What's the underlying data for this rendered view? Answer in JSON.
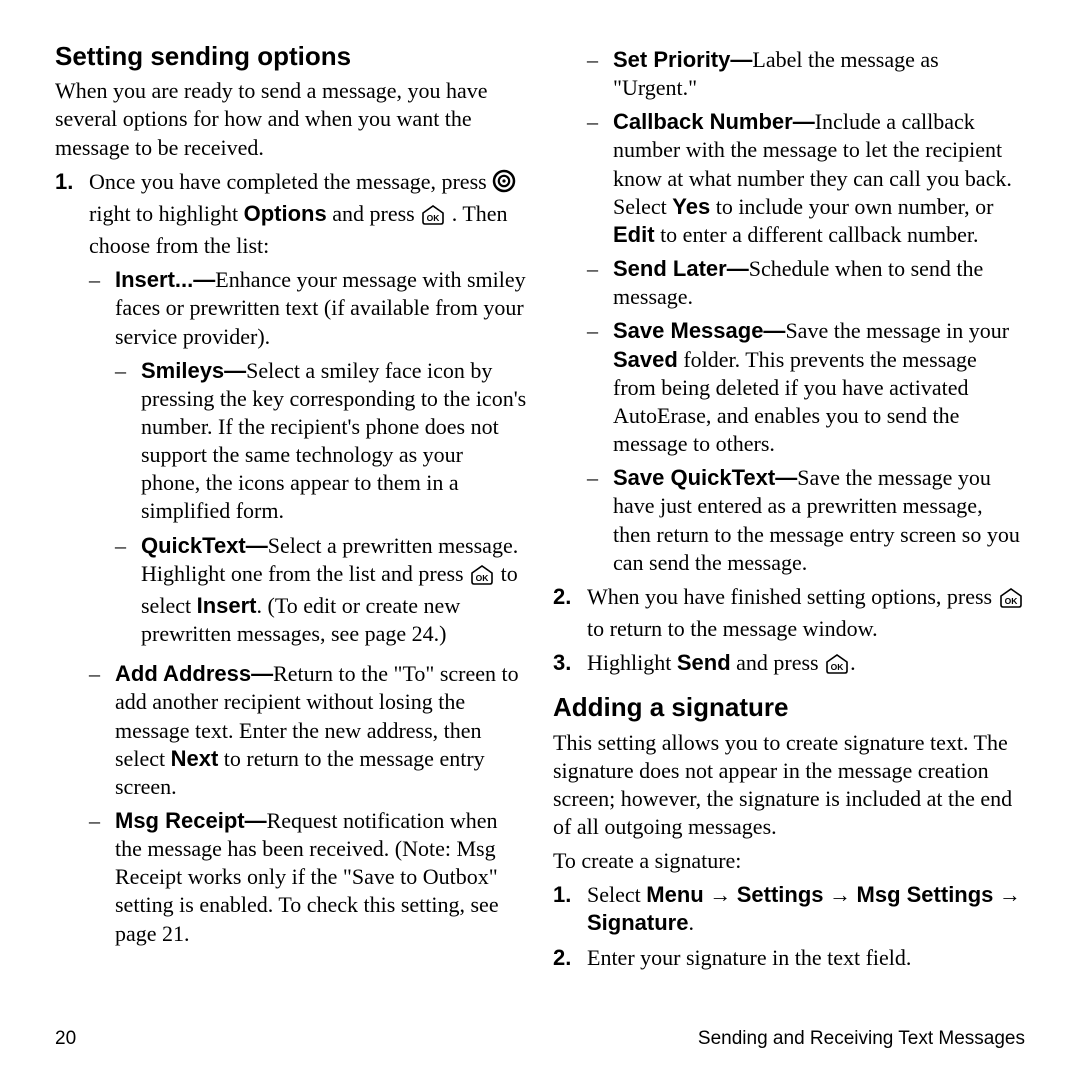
{
  "section1": {
    "title": "Setting sending options",
    "intro": "When you are ready to send a message, you have several options for how and when you want the message to be received.",
    "step1": {
      "num": "1.",
      "pre": "Once you have completed the message, press ",
      "mid1": " right to highlight ",
      "options_word": "Options",
      "mid2": " and press ",
      "post": ". Then choose from the list:",
      "insert_label": "Insert...—",
      "insert_text": "Enhance your message with smiley faces or prewritten text (if available from your service provider).",
      "smileys_label": "Smileys—",
      "smileys_text": "Select a smiley face icon by pressing the key corresponding to the icon's number. If the recipient's phone does not support the same technology as your phone, the icons appear to them in a simplified form.",
      "quicktext_label": "QuickText—",
      "quicktext_pre": "Select a prewritten message. Highlight one from the list and press ",
      "quicktext_mid1": " to select ",
      "quicktext_insert_word": "Insert",
      "quicktext_post": ". (To edit or create new prewritten messages, see page 24.)",
      "addaddr_label": "Add Address—",
      "addaddr_pre": "Return to the \"To\" screen to add another recipient without losing the message text. Enter the new address, then select ",
      "addaddr_next_word": "Next",
      "addaddr_post": " to return to the message entry screen.",
      "msgreceipt_label": "Msg Receipt—",
      "msgreceipt_text": "Request notification when the message has been received. (Note: Msg Receipt works only if the \"Save to Outbox\" setting is enabled. To check this setting, see page 21.",
      "setpriority_label": "Set Priority—",
      "setpriority_text": "Label the message as \"Urgent.\"",
      "callback_label": "Callback Number—",
      "callback_pre": "Include a callback number with the message to let the recipient know at what number they can call you back. Select ",
      "callback_yes": "Yes",
      "callback_mid": " to include your own number, or ",
      "callback_edit": "Edit",
      "callback_post": " to enter a different callback number.",
      "sendlater_label": "Send Later—",
      "sendlater_text": "Schedule when to send the message.",
      "savemsg_label": "Save Message—",
      "savemsg_pre": "Save the message in your ",
      "savemsg_saved": "Saved",
      "savemsg_post": " folder. This prevents the message from being deleted if you have activated AutoErase, and enables you to send the message to others.",
      "savequick_label": "Save QuickText—",
      "savequick_text": "Save the message you have just entered as a prewritten message, then return to the message entry screen so you can send the message."
    },
    "step2": {
      "num": "2.",
      "pre": "When you have finished setting options, press ",
      "post": " to return to the message window."
    },
    "step3": {
      "num": "3.",
      "pre": "Highlight ",
      "send_word": "Send",
      "mid": " and press ",
      "post": "."
    }
  },
  "section2": {
    "title": "Adding a signature",
    "intro": "This setting allows you to create signature text. The signature does not appear in the message creation screen; however, the signature is included at the end of all outgoing messages.",
    "lead": "To create a signature:",
    "step1": {
      "num": "1.",
      "select": "Select ",
      "menu": "Menu",
      "settings": "Settings",
      "msgsettings": "Msg Settings",
      "signature": "Signature",
      "arrow": " → ",
      "period": "."
    },
    "step2": {
      "num": "2.",
      "text": "Enter your signature in the text field."
    }
  },
  "footer": {
    "page": "20",
    "title": "Sending and Receiving Text Messages"
  }
}
